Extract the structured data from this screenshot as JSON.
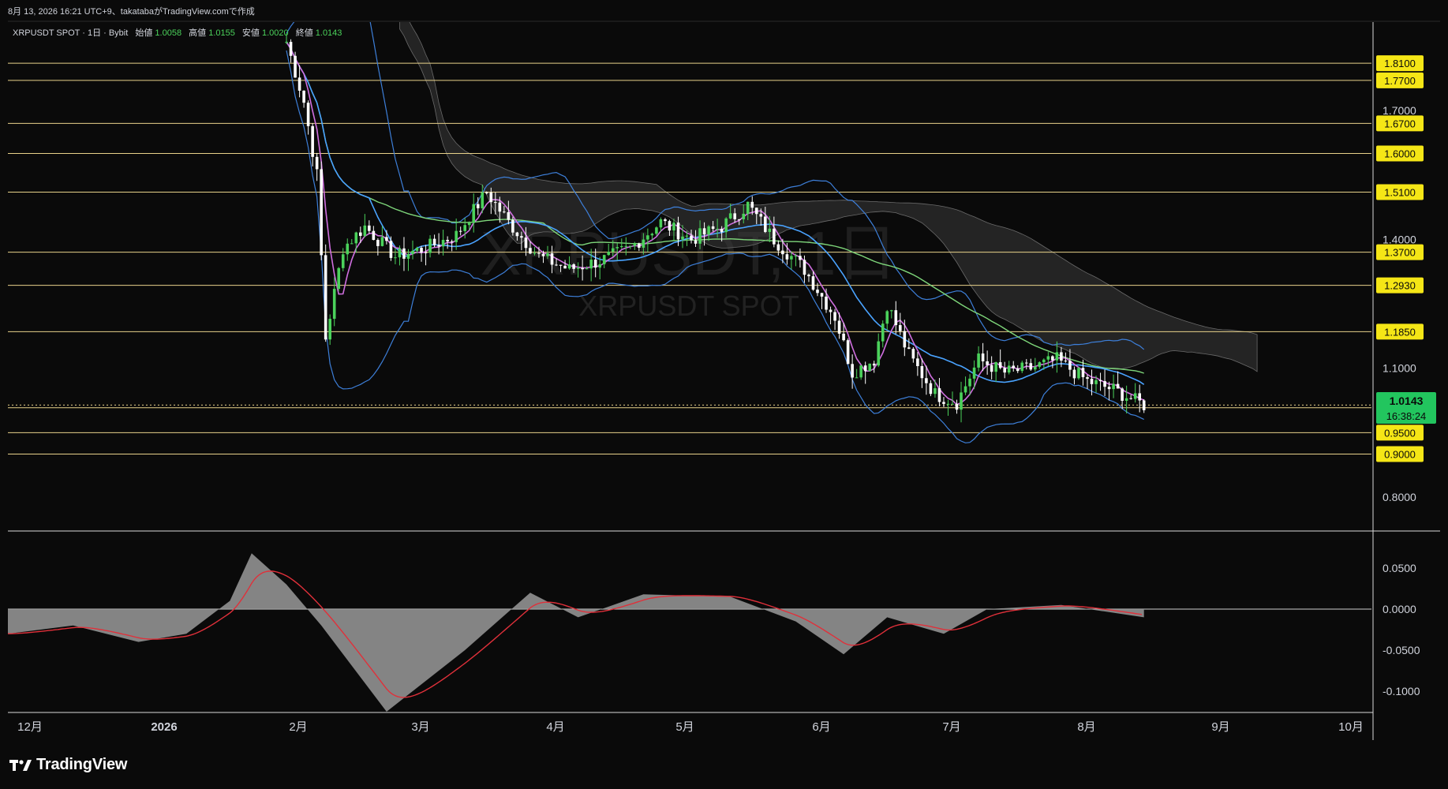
{
  "header": {
    "caption": "8月 13, 2026 16:21 UTC+9、takatabaがTradingView.comで作成",
    "symbol_line": {
      "prefix": "XRPUSDT SPOT · 1日 · Bybit",
      "open_label": "始値",
      "open_value": "1.0058",
      "high_label": "高値",
      "high_value": "1.0155",
      "low_label": "安値",
      "low_value": "1.0020",
      "close_label": "終値",
      "close_value": "1.0143"
    }
  },
  "watermark": {
    "main": "XRPUSDT, 1日",
    "sub": "XRPUSDT SPOT"
  },
  "logo": {
    "text": "TradingView"
  },
  "colors": {
    "background": "#0a0a0a",
    "up": "#4bd25b",
    "down": "#ffffff",
    "level": "#e8d28a",
    "level_label_bg": "#f5e616",
    "bollinger": "#3d7fd9",
    "ma_fast": "#d06fe0",
    "ma_mid": "#4aa3ff",
    "ma_long": "#7ed67a",
    "kumo": "#3a3a3a",
    "current_price_bg": "#22c55e",
    "macd_hist": "#9a9a9a",
    "macd_signal": "#e0303a"
  },
  "chart_data": [
    {
      "type": "candlestick",
      "title": "XRPUSDT SPOT · 1日 · Bybit",
      "x_axis_labels": [
        "12月",
        "2026",
        "2月",
        "3月",
        "4月",
        "5月",
        "6月",
        "7月",
        "8月",
        "9月",
        "10月"
      ],
      "y_axis_ticks": [
        "1.7000",
        "1.4000",
        "1.1000",
        "0.8000"
      ],
      "ylim": [
        0.7,
        1.85
      ],
      "horizontal_levels": [
        "1.8100",
        "1.7700",
        "1.6700",
        "1.6000",
        "1.5100",
        "1.3700",
        "1.2930",
        "1.1850",
        "1.0080",
        "0.9500",
        "0.9000"
      ],
      "current_price": "1.0143",
      "countdown": "16:38:24",
      "close_series_approx": [
        {
          "date": "2026-01-28",
          "close": 1.86
        },
        {
          "date": "2026-02-01",
          "close": 1.72
        },
        {
          "date": "2026-02-04",
          "close": 1.55
        },
        {
          "date": "2026-02-06",
          "close": 1.17
        },
        {
          "date": "2026-02-10",
          "close": 1.38
        },
        {
          "date": "2026-02-15",
          "close": 1.43
        },
        {
          "date": "2026-02-22",
          "close": 1.36
        },
        {
          "date": "2026-03-01",
          "close": 1.38
        },
        {
          "date": "2026-03-08",
          "close": 1.41
        },
        {
          "date": "2026-03-15",
          "close": 1.51
        },
        {
          "date": "2026-03-20",
          "close": 1.44
        },
        {
          "date": "2026-03-27",
          "close": 1.36
        },
        {
          "date": "2026-04-03",
          "close": 1.33
        },
        {
          "date": "2026-04-10",
          "close": 1.35
        },
        {
          "date": "2026-04-17",
          "close": 1.38
        },
        {
          "date": "2026-04-24",
          "close": 1.44
        },
        {
          "date": "2026-05-01",
          "close": 1.4
        },
        {
          "date": "2026-05-08",
          "close": 1.43
        },
        {
          "date": "2026-05-14",
          "close": 1.48
        },
        {
          "date": "2026-05-20",
          "close": 1.4
        },
        {
          "date": "2026-05-27",
          "close": 1.33
        },
        {
          "date": "2026-06-03",
          "close": 1.22
        },
        {
          "date": "2026-06-07",
          "close": 1.09
        },
        {
          "date": "2026-06-12",
          "close": 1.12
        },
        {
          "date": "2026-06-15",
          "close": 1.25
        },
        {
          "date": "2026-06-20",
          "close": 1.13
        },
        {
          "date": "2026-06-26",
          "close": 1.04
        },
        {
          "date": "2026-07-01",
          "close": 1.02
        },
        {
          "date": "2026-07-06",
          "close": 1.12
        },
        {
          "date": "2026-07-12",
          "close": 1.09
        },
        {
          "date": "2026-07-18",
          "close": 1.1
        },
        {
          "date": "2026-07-24",
          "close": 1.12
        },
        {
          "date": "2026-07-31",
          "close": 1.07
        },
        {
          "date": "2026-08-06",
          "close": 1.05
        },
        {
          "date": "2026-08-13",
          "close": 1.0143
        }
      ]
    },
    {
      "type": "area",
      "title": "MACD",
      "y_axis_ticks": [
        "0.0500",
        "0.0000",
        "-0.0500",
        "-0.1000"
      ],
      "ylim": [
        -0.13,
        0.08
      ],
      "histogram_approx": [
        {
          "date": "2025-11-25",
          "value": -0.03
        },
        {
          "date": "2025-12-10",
          "value": -0.02
        },
        {
          "date": "2025-12-25",
          "value": -0.04
        },
        {
          "date": "2026-01-05",
          "value": -0.03
        },
        {
          "date": "2026-01-15",
          "value": 0.01
        },
        {
          "date": "2026-01-20",
          "value": 0.068
        },
        {
          "date": "2026-01-28",
          "value": 0.03
        },
        {
          "date": "2026-02-05",
          "value": -0.02
        },
        {
          "date": "2026-02-20",
          "value": -0.125
        },
        {
          "date": "2026-03-10",
          "value": -0.05
        },
        {
          "date": "2026-03-25",
          "value": 0.02
        },
        {
          "date": "2026-04-05",
          "value": -0.01
        },
        {
          "date": "2026-04-20",
          "value": 0.018
        },
        {
          "date": "2026-05-10",
          "value": 0.015
        },
        {
          "date": "2026-05-25",
          "value": -0.015
        },
        {
          "date": "2026-06-05",
          "value": -0.055
        },
        {
          "date": "2026-06-15",
          "value": -0.01
        },
        {
          "date": "2026-06-28",
          "value": -0.03
        },
        {
          "date": "2026-07-08",
          "value": 0.0
        },
        {
          "date": "2026-07-25",
          "value": 0.005
        },
        {
          "date": "2026-08-13",
          "value": -0.01
        }
      ]
    }
  ]
}
